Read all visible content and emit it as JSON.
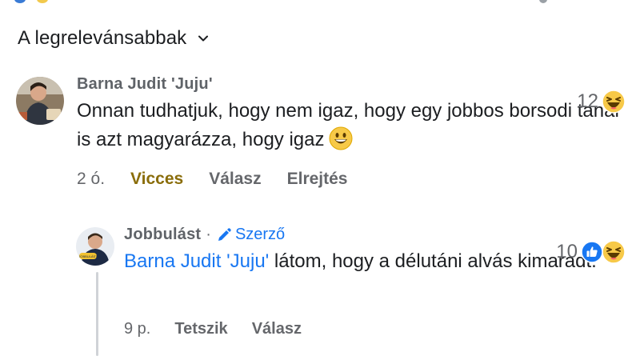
{
  "sort": {
    "label": "A legrelevánsabbak",
    "icon": "chevron-down-icon"
  },
  "comments": [
    {
      "author": "Barna Judit 'Juju'",
      "text": "Onnan tudhatjuk, hogy nem igaz, hogy egy jobbos borsodi tanár is azt magyarázza, hogy igaz",
      "inline_emoji": "grinning-face-icon",
      "time": "2 ó.",
      "reaction_label": "Vicces",
      "actions": [
        "Válasz",
        "Elrejtés"
      ],
      "reaction_count": "12",
      "reaction_icons": [
        "haha-reaction-icon"
      ]
    }
  ],
  "reply": {
    "author": "Jobbulást",
    "separator": "·",
    "badge": "Szerző",
    "mention": "Barna Judit 'Juju'",
    "text": " látom, hogy a délutáni alvás kimaradt.",
    "time": "9 p.",
    "actions": [
      "Tetszik",
      "Válasz"
    ],
    "reaction_count": "10",
    "reaction_icons": [
      "like-reaction-icon",
      "haha-reaction-icon"
    ]
  },
  "colors": {
    "link": "#1877f2",
    "funny": "#8a6d0a",
    "muted": "#65676b"
  }
}
